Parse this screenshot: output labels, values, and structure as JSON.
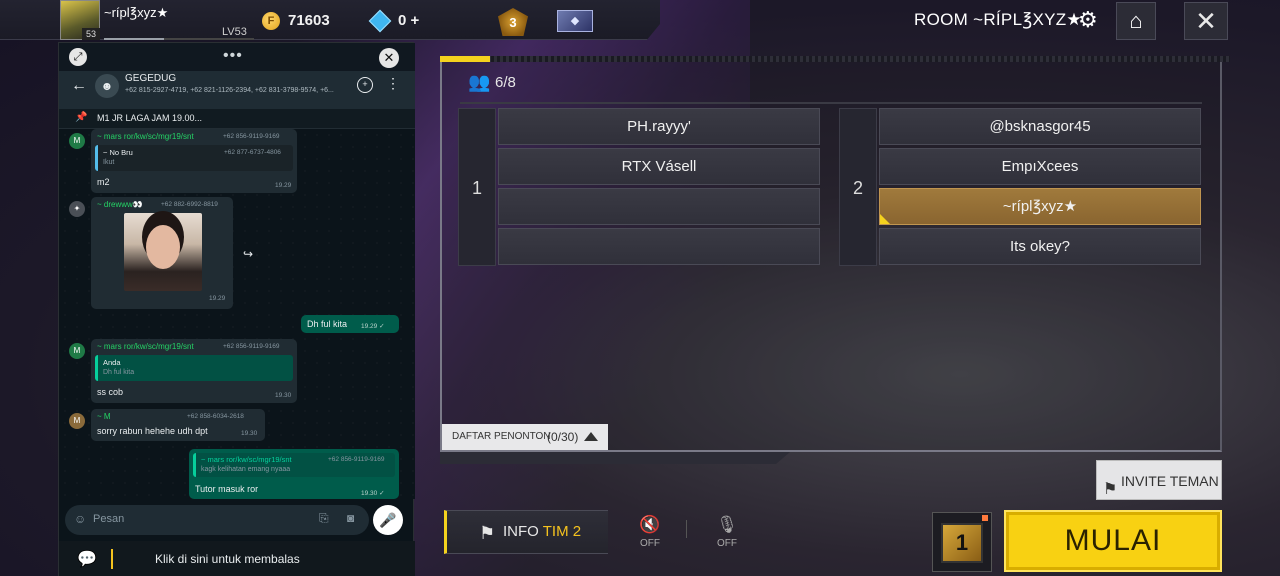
{
  "topbar": {
    "player_name": "~rípl℥xyz★",
    "avatar_badge": "53",
    "level": "LV53",
    "coins": "71603",
    "coin_symbol": "F",
    "diamonds": "0",
    "diamonds_add": "+",
    "rank_badge": "3",
    "room_title": "ROOM ~RÍPL℥XYZ★",
    "xp_progress": 0.4
  },
  "room": {
    "player_count": "6/8",
    "team1": {
      "number": "1",
      "slots": [
        "PH.rayyy'",
        "RTX    Vásell",
        "",
        ""
      ]
    },
    "team2": {
      "number": "2",
      "slots": [
        "@bsknasgor45",
        "EmpıXcees",
        "~rípl℥xyz★",
        "Its        okey?"
      ],
      "highlight_index": 2
    },
    "spectator_label": "DAFTAR PENONTON",
    "spectator_count": "(0/30)",
    "invite_label": "INVITE TEMAN"
  },
  "bottom": {
    "info_prefix": "INFO",
    "info_team": "TIM 2",
    "speaker_state": "OFF",
    "mic_state": "OFF",
    "mode_number": "1",
    "start_label": "MULAI"
  },
  "whatsapp": {
    "group_name": "GEGEDUG",
    "group_members": "+62 815-2927-4719, +62 821-1126-2394, +62 831-3798-9574, +6...",
    "pinned_text": "M1 JR LAGA JAM 19.00...",
    "messages": {
      "m1": {
        "avatar": "M",
        "sender": "~ mars ror/kw/sc/mgr19/snt",
        "phone": "+62 856-9119-9169",
        "quote_name": "~ No Bru",
        "quote_phone": "+62 877-6737-4806",
        "quote_text": "Ikut",
        "text": "m2",
        "time": "19.29"
      },
      "m2": {
        "sender": "~ drewww👀",
        "phone": "+62 882-6992-8819",
        "time": "19.29"
      },
      "m3": {
        "text": "Dh ful kita",
        "time": "19.29 ✓"
      },
      "m4": {
        "avatar": "M",
        "sender": "~ mars ror/kw/sc/mgr19/snt",
        "phone": "+62 856-9119-9169",
        "quote_name": "Anda",
        "quote_text": "Dh ful kita",
        "text": "ss cob",
        "time": "19.30"
      },
      "m5": {
        "avatar": "M",
        "sender": "~ M",
        "phone": "+62 858-6034-2618",
        "text": "sorry rabun hehehe udh dpt",
        "time": "19.30"
      },
      "m6": {
        "quote_name": "~ mars ror/kw/sc/mgr19/snt",
        "quote_phone": "+62 856-9119-9169",
        "quote_text": "kagk kelihatan emang nyaaa",
        "text": "Tutor masuk ror",
        "time": "19.30 ✓"
      }
    },
    "input_placeholder": "Pesan",
    "reply_hint": "Klik di sini untuk membalas"
  }
}
